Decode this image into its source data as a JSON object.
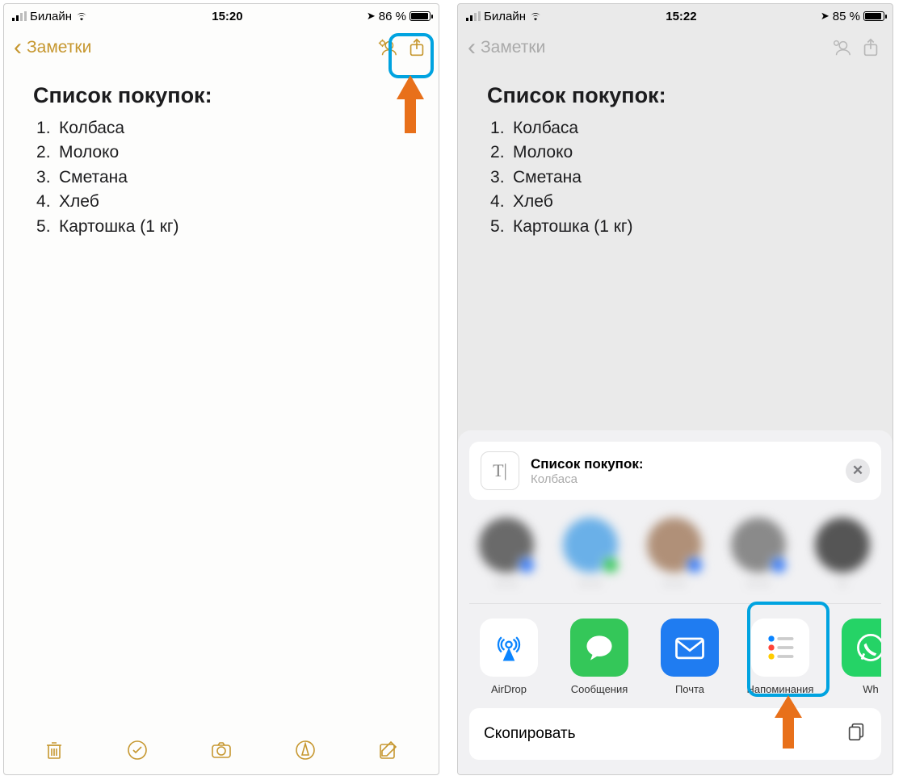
{
  "left": {
    "status": {
      "carrier": "Билайн",
      "time": "15:20",
      "battery_pct": "86 %",
      "battery_fill": 86
    },
    "nav": {
      "back_label": "Заметки"
    },
    "note": {
      "title": "Список покупок:",
      "items": [
        "Колбаса",
        "Молоко",
        "Сметана",
        "Хлеб",
        "Картошка (1 кг)"
      ]
    }
  },
  "right": {
    "status": {
      "carrier": "Билайн",
      "time": "15:22",
      "battery_pct": "85 %",
      "battery_fill": 85
    },
    "nav": {
      "back_label": "Заметки"
    },
    "note": {
      "title": "Список покупок:",
      "items": [
        "Колбаса",
        "Молоко",
        "Сметана",
        "Хлеб",
        "Картошка (1 кг)"
      ]
    },
    "share": {
      "doc_title": "Список покупок:",
      "doc_sub": "Колбаса",
      "apps": [
        {
          "id": "airdrop",
          "label": "AirDrop"
        },
        {
          "id": "messages",
          "label": "Сообщения"
        },
        {
          "id": "mail",
          "label": "Почта"
        },
        {
          "id": "reminders",
          "label": "Напоминания"
        },
        {
          "id": "whatsapp",
          "label": "Wh"
        }
      ],
      "action_copy": "Скопировать"
    }
  }
}
